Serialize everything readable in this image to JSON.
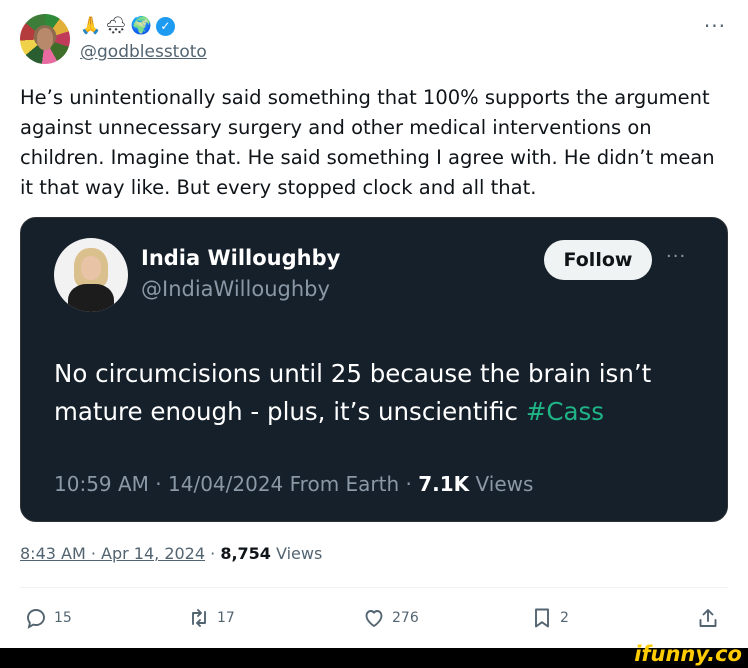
{
  "author": {
    "emojis": [
      "🙏",
      "🌨",
      "🌍"
    ],
    "handle": "@godblesstoto",
    "more": "···"
  },
  "tweet": {
    "text": "He’s unintentionally said something that 100% supports the argument against unnecessary surgery and other medical interventions on children. Imagine that. He said something I agree with. He didn’t mean it that way like. But every stopped clock and all that."
  },
  "embedded": {
    "name": "India Willoughby",
    "handle": "@IndiaWilloughby",
    "follow_label": "Follow",
    "more": "···",
    "text": "No circumcisions until 25 because the brain isn’t mature enough - plus, it’s unscientific ",
    "hashtag": "#Cass",
    "meta_time": "10:59 AM · 14/04/2024 From Earth · ",
    "views_count": "7.1K",
    "views_label": " Views"
  },
  "meta": {
    "time": "8:43 AM · Apr 14, 2024",
    "separator": " · ",
    "views_count": "8,754",
    "views_label": " Views"
  },
  "actions": {
    "replies": "15",
    "reposts": "17",
    "likes": "276",
    "bookmarks": "2"
  },
  "watermark": "ifunny.co",
  "colors": {
    "link_green": "#1fb486",
    "embed_bg": "#15202b",
    "muted": "#536471"
  }
}
